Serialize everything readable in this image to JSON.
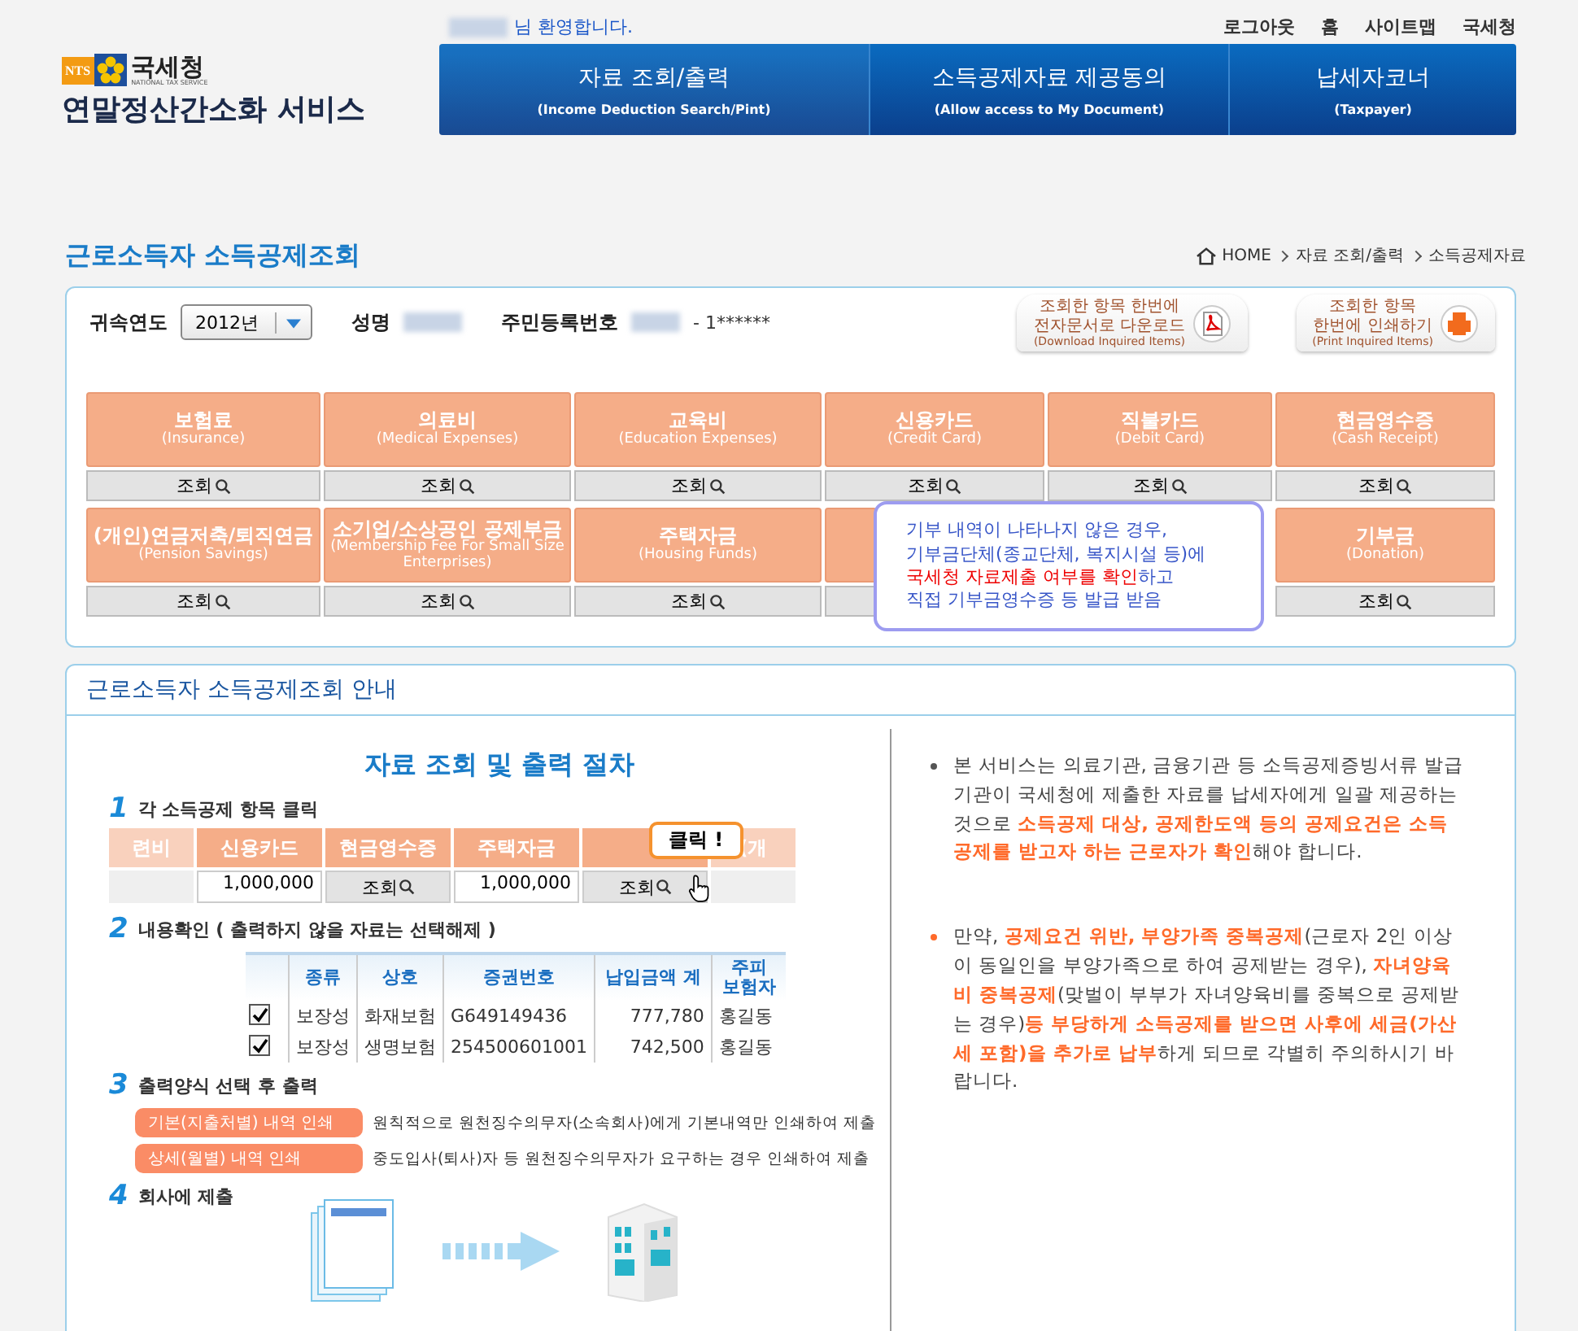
{
  "top_bar": {
    "welcome": "님 환영합니다.",
    "links": [
      "로그아웃",
      "홈",
      "사이트맵",
      "국세청"
    ]
  },
  "logo": {
    "badge": "NTS",
    "org": "국세청",
    "org_en": "NATIONAL TAX SERVICE",
    "service": "연말정산간소화 서비스"
  },
  "nav": [
    {
      "title": "자료 조회/출력",
      "subtitle": "(Income Deduction Search/Pint)",
      "selected": true
    },
    {
      "title": "소득공제자료 제공동의",
      "subtitle": "(Allow access to My Document)",
      "selected": false
    },
    {
      "title": "납세자코너",
      "subtitle": "(Taxpayer)",
      "selected": false
    }
  ],
  "page_title": "근로소득자 소득공제조회",
  "breadcrumb": [
    "HOME",
    "자료 조회/출력",
    "소득공제자료"
  ],
  "info": {
    "year_label": "귀속연도",
    "year_value": "2012년",
    "name_label": "성명",
    "id_label": "주민등록번호",
    "id_value": "- 1******"
  },
  "actions": [
    {
      "kind": "pdf",
      "lines": [
        "조회한 항목 한번에",
        "전자문서로 다운로드"
      ],
      "subtitle": "(Download Inquired Items)"
    },
    {
      "kind": "print",
      "lines": [
        "조회한 항목",
        "한번에 인쇄하기"
      ],
      "subtitle": "(Print Inquired Items)"
    }
  ],
  "categories": [
    {
      "title": "보험료",
      "subtitle": "(Insurance)",
      "button": "조회"
    },
    {
      "title": "의료비",
      "subtitle": "(Medical Expenses)",
      "button": "조회"
    },
    {
      "title": "교육비",
      "subtitle": "(Education Expenses)",
      "button": "조회"
    },
    {
      "title": "신용카드",
      "subtitle": "(Credit Card)",
      "button": "조회"
    },
    {
      "title": "직불카드",
      "subtitle": "(Debit Card)",
      "button": "조회"
    },
    {
      "title": "현금영수증",
      "subtitle": "(Cash Receipt)",
      "button": "조회"
    },
    {
      "title": "(개인)연금저축/퇴직연금",
      "subtitle": "(Pension Savings)",
      "button": "조회"
    },
    {
      "title": "소기업/소상공인 공제부금",
      "subtitle": "(Membership Fee For Small Size Enterprises)",
      "button": "조회"
    },
    {
      "title": "주택자금",
      "subtitle": "(Housing Funds)",
      "button": "조회"
    },
    {
      "title": "기부금",
      "subtitle": "(Donation)",
      "button": "조회"
    }
  ],
  "tooltip": [
    "기부 내역이 나타나지 않은 경우,",
    "기부금단체(종교단체, 복지시설 등)에",
    "**국세청 자료제출 여부를 확인**하고",
    "직접 기부금영수증 등 발급 받음"
  ],
  "guide": {
    "heading": "근로소득자 소득공제조회 안내",
    "title": "자료 조회 및 출력 절차",
    "steps": [
      {
        "number": "1",
        "text": "각 소득공제 항목 클릭"
      },
      {
        "number": "2",
        "text": "내용확인 ( 출력하지 않을 자료는 선택해제 )"
      },
      {
        "number": "3",
        "text": "출력양식 선택 후 출력"
      },
      {
        "number": "4",
        "text": "회사에 제출"
      }
    ],
    "demo_cells": [
      {
        "head": "련비"
      },
      {
        "head": "신용카드",
        "value": "1,000,000"
      },
      {
        "head": "현금영수증",
        "button": "조회"
      },
      {
        "head": "주택자금",
        "value": "1,000,000"
      },
      {
        "button": "조회"
      },
      {
        "head": "(개"
      }
    ],
    "click_bubble": "클릭 !",
    "table": {
      "columns": [
        "종류",
        "상호",
        "증권번호",
        "납입금액 계",
        "주피\n보험자"
      ],
      "rows": [
        {
          "checked": true,
          "cells": [
            "보장성",
            "화재보험",
            "G649149436",
            "777,780",
            "홍길동"
          ]
        },
        {
          "checked": true,
          "cells": [
            "보장성",
            "생명보험",
            "254500601001",
            "742,500",
            "홍길동"
          ]
        }
      ]
    },
    "print_options": [
      {
        "button": "기본(지출처별) 내역 인쇄",
        "text": "원칙적으로 원천징수의무자(소속회사)에게 기본내역만 인쇄하여 제출"
      },
      {
        "button": "상세(월별) 내역 인쇄",
        "text": "중도입사(퇴사)자 등 원천징수의무자가 요구하는 경우 인쇄하여 제출"
      }
    ],
    "notes": [
      {
        "color": "#555555",
        "text": "본 서비스는 의료기관, 금융기관 등 소득공제증빙서류 발급기관이 국세청에 제출한 자료를 납세자에게 일괄 제공하는 것으로 **소득공제 대상, 공제한도액 등의 공제요건은 소득공제를 받고자 하는 근로자가 확인**해야 합니다."
      },
      {
        "color": "#ff6a2a",
        "text": "만약, **공제요건 위반, 부양가족 중복공제**(근로자 2인 이상이 동일인을 부양가족으로 하여 공제받는 경우), **자녀양육비 중복공제**(맞벌이 부부가 자녀양육비를 중복으로 공제받는 경우)**등 부당하게 소득공제를 받으면 사후에 세금(가산세 포함)을 추가로 납부**하게 되므로 각별히 주의하시기 바랍니다."
      }
    ]
  }
}
